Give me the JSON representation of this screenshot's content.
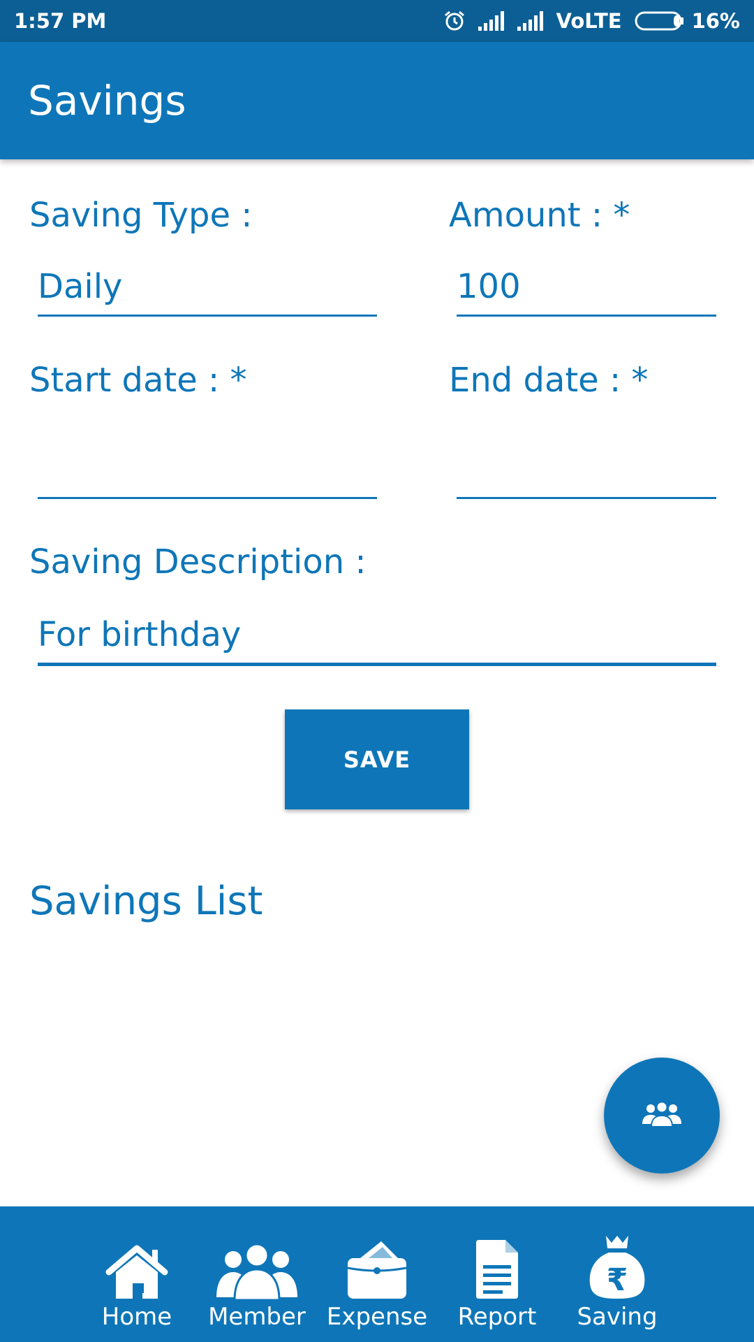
{
  "status_bar": {
    "time": "1:57 PM",
    "network": "VoLTE",
    "battery": "16%",
    "icons": [
      "alarm-icon",
      "signal-icon",
      "signal-icon",
      "battery-icon"
    ]
  },
  "app_bar": {
    "title": "Savings"
  },
  "form": {
    "saving_type": {
      "label": "Saving Type :",
      "value": "Daily"
    },
    "amount": {
      "label": "Amount : *",
      "value": "100"
    },
    "start_date": {
      "label": "Start date : *",
      "value": ""
    },
    "end_date": {
      "label": "End date : *",
      "value": ""
    },
    "description": {
      "label": "Saving Description :",
      "value": "For birthday"
    },
    "save_label": "SAVE"
  },
  "savings_list": {
    "title": "Savings List"
  },
  "fab": {
    "icon": "group-icon"
  },
  "bottom_nav": {
    "items": [
      {
        "label": "Home",
        "icon": "home-icon"
      },
      {
        "label": "Member",
        "icon": "members-icon"
      },
      {
        "label": "Expense",
        "icon": "wallet-icon"
      },
      {
        "label": "Report",
        "icon": "report-icon"
      },
      {
        "label": "Saving",
        "icon": "money-bag-icon"
      }
    ]
  },
  "colors": {
    "primary": "#0e76b8",
    "status_bar": "#0c5f94",
    "background": "#ffffff"
  }
}
